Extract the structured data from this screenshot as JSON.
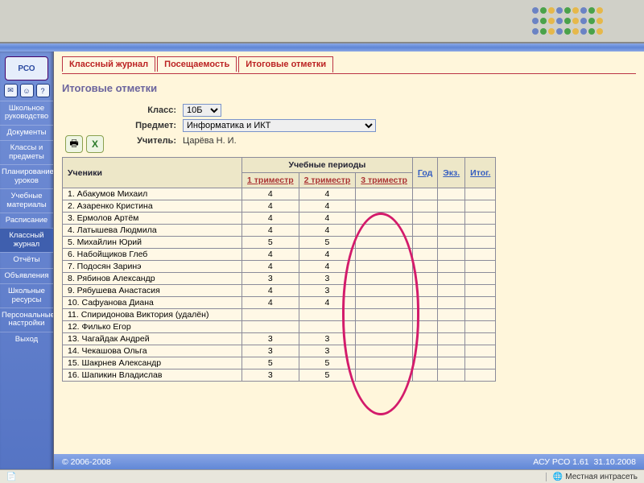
{
  "brand": "РСО",
  "tabs": [
    {
      "label": "Классный журнал",
      "active": false
    },
    {
      "label": "Посещаемость",
      "active": false
    },
    {
      "label": "Итоговые отметки",
      "active": true
    }
  ],
  "pageTitle": "Итоговые отметки",
  "filters": {
    "classLabel": "Класс:",
    "classValue": "10Б",
    "subjectLabel": "Предмет:",
    "subjectValue": "Информатика и ИКТ",
    "teacherLabel": "Учитель:",
    "teacherValue": "Царёва Н. И."
  },
  "sidebar": [
    "Школьное руководство",
    "Документы",
    "Классы и предметы",
    "Планирование уроков",
    "Учебные материалы",
    "Расписание",
    "Классный журнал",
    "Отчёты",
    "Объявления",
    "Школьные ресурсы",
    "Персональные настройки",
    "Выход"
  ],
  "sidebarActive": "Классный журнал",
  "table": {
    "studentsHeader": "Ученики",
    "periodsHeader": "Учебные периоды",
    "cols": [
      "1 триместр",
      "2 триместр",
      "3 триместр",
      "Год",
      "Экз.",
      "Итог."
    ],
    "rows": [
      {
        "n": "1.",
        "name": "Абакумов Михаил",
        "p1": "4",
        "p2": "4"
      },
      {
        "n": "2.",
        "name": "Азаренко Кристина",
        "p1": "4",
        "p2": "4"
      },
      {
        "n": "3.",
        "name": "Ермолов Артём",
        "p1": "4",
        "p2": "4"
      },
      {
        "n": "4.",
        "name": "Латышева Людмила",
        "p1": "4",
        "p2": "4"
      },
      {
        "n": "5.",
        "name": "Михайлин Юрий",
        "p1": "5",
        "p2": "5"
      },
      {
        "n": "6.",
        "name": "Набойщиков Глеб",
        "p1": "4",
        "p2": "4"
      },
      {
        "n": "7.",
        "name": "Подосян Заринэ",
        "p1": "4",
        "p2": "4"
      },
      {
        "n": "8.",
        "name": "Рябинов Александр",
        "p1": "3",
        "p2": "3"
      },
      {
        "n": "9.",
        "name": "Рябушева Анастасия",
        "p1": "4",
        "p2": "3"
      },
      {
        "n": "10.",
        "name": "Сафуанова Диана",
        "p1": "4",
        "p2": "4"
      },
      {
        "n": "11.",
        "name": "Спиридонова Виктория (удалён)",
        "p1": "",
        "p2": ""
      },
      {
        "n": "12.",
        "name": "Филько Егор",
        "p1": "",
        "p2": ""
      },
      {
        "n": "13.",
        "name": "Чагайдак Андрей",
        "p1": "3",
        "p2": "3"
      },
      {
        "n": "14.",
        "name": "Чекашова Ольга",
        "p1": "3",
        "p2": "3"
      },
      {
        "n": "15.",
        "name": "Шакрнев Александр",
        "p1": "5",
        "p2": "5"
      },
      {
        "n": "16.",
        "name": "Шапикин Владислав",
        "p1": "3",
        "p2": "5"
      }
    ]
  },
  "footer": {
    "copyright": "© 2006-2008",
    "version": "АСУ РСО 1.61",
    "date": "31.10.2008"
  },
  "status": {
    "zone": "Местная интрасеть"
  },
  "dotColors": [
    "#6b83c4",
    "#4aa24a",
    "#e6b84a",
    "#c0662a"
  ]
}
